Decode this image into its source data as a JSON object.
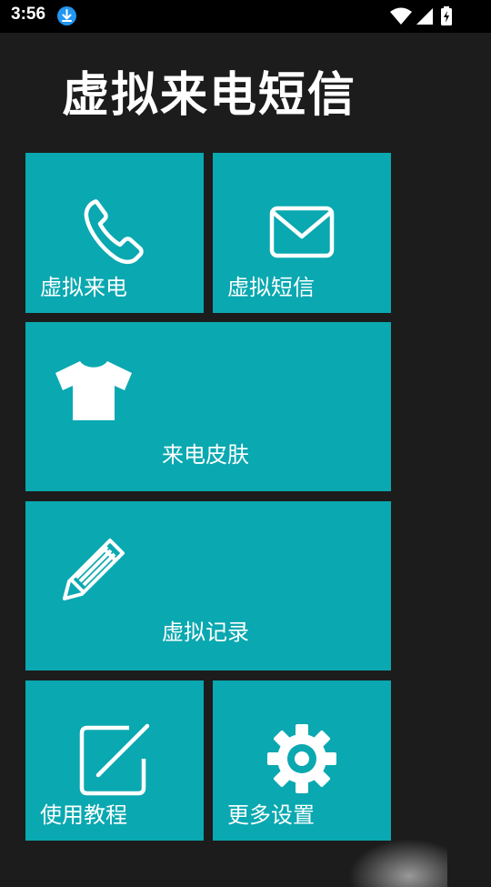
{
  "status_bar": {
    "time": "3:56",
    "icons": [
      "download-icon",
      "wifi-icon",
      "signal-icon",
      "battery-charging-icon"
    ]
  },
  "app": {
    "title": "虚拟来电短信"
  },
  "tiles": [
    {
      "label": "虚拟来电",
      "icon": "phone-icon"
    },
    {
      "label": "虚拟短信",
      "icon": "envelope-icon"
    },
    {
      "label": "来电皮肤",
      "icon": "tshirt-icon"
    },
    {
      "label": "虚拟记录",
      "icon": "pencil-icon"
    },
    {
      "label": "使用教程",
      "icon": "edit-square-icon"
    },
    {
      "label": "更多设置",
      "icon": "gear-icon"
    }
  ],
  "colors": {
    "background": "#1c1c1c",
    "tile": "#0aa8b0",
    "status_bar": "#000000",
    "download_badge": "#2196f3"
  }
}
